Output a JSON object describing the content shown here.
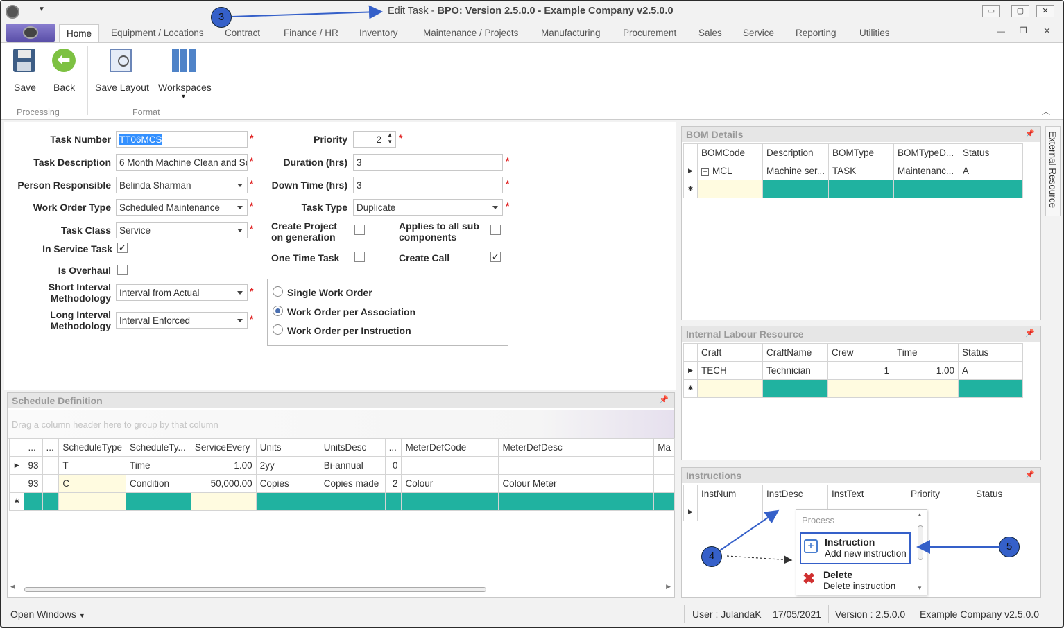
{
  "window": {
    "title": "Edit Task",
    "title_app": "BPO: Version 2.5.0.0 - Example Company v2.5.0.0",
    "minimize": "▭",
    "maximize": "▢",
    "close": "✕"
  },
  "ribbon_tabs": [
    "Home",
    "Equipment / Locations",
    "Contract",
    "Finance / HR",
    "Inventory",
    "Maintenance / Projects",
    "Manufacturing",
    "Procurement",
    "Sales",
    "Service",
    "Reporting",
    "Utilities"
  ],
  "ribbon": {
    "save": "Save",
    "back": "Back",
    "save_layout": "Save Layout",
    "workspaces": "Workspaces",
    "group_processing": "Processing",
    "group_format": "Format"
  },
  "form": {
    "task_number_label": "Task Number",
    "task_number": "TT06MCS",
    "task_description_label": "Task Description",
    "task_description": "6 Month Machine Clean and Se",
    "person_responsible_label": "Person Responsible",
    "person_responsible": "Belinda Sharman",
    "work_order_type_label": "Work Order Type",
    "work_order_type": "Scheduled Maintenance",
    "task_class_label": "Task Class",
    "task_class": "Service",
    "in_service_task_label": "In Service Task",
    "in_service_task": true,
    "is_overhaul_label": "Is Overhaul",
    "is_overhaul": false,
    "short_interval_label": "Short Interval Methodology",
    "short_interval_label_1": "Short Interval",
    "short_interval_label_2": "Methodology",
    "short_interval": "Interval from Actual",
    "long_interval_label_1": "Long Interval",
    "long_interval_label_2": "Methodology",
    "long_interval": "Interval Enforced",
    "priority_label": "Priority",
    "priority": "2",
    "duration_label": "Duration (hrs)",
    "duration": "3",
    "down_time_label": "Down Time (hrs)",
    "down_time": "3",
    "task_type_label": "Task Type",
    "task_type": "Duplicate",
    "create_project_label_1": "Create Project",
    "create_project_label_2": "on generation",
    "create_project": false,
    "applies_label_1": "Applies to all sub",
    "applies_label_2": "components",
    "applies": false,
    "one_time_label": "One Time Task",
    "one_time": false,
    "create_call_label": "Create Call",
    "create_call": true,
    "radio_single": "Single Work Order",
    "radio_association": "Work Order per Association",
    "radio_instruction": "Work Order per Instruction",
    "selected_radio": "Work Order per Association"
  },
  "schedule": {
    "title": "Schedule Definition",
    "group_hint": "Drag a column header here to group by that column",
    "columns": [
      "...",
      "...",
      "ScheduleType",
      "ScheduleTy...",
      "ServiceEvery",
      "Units",
      "UnitsDesc",
      "...",
      "MeterDefCode",
      "MeterDefDesc",
      "Ma"
    ],
    "rows": [
      [
        "93",
        "",
        "T",
        "Time",
        "1.00",
        "2yy",
        "Bi-annual",
        "0",
        "",
        "",
        ""
      ],
      [
        "93",
        "",
        "C",
        "Condition",
        "50,000.00",
        "Copies",
        "Copies made",
        "2",
        "Colour",
        "Colour Meter",
        ""
      ]
    ]
  },
  "bom": {
    "title": "BOM Details",
    "columns": [
      "BOMCode",
      "Description",
      "BOMType",
      "BOMTypeD...",
      "Status"
    ],
    "rows": [
      [
        "MCL",
        "Machine ser...",
        "TASK",
        "Maintenanc...",
        "A"
      ]
    ]
  },
  "labour": {
    "title": "Internal Labour Resource",
    "columns": [
      "Craft",
      "CraftName",
      "Crew",
      "Time",
      "Status"
    ],
    "rows": [
      [
        "TECH",
        "Technician",
        "1",
        "1.00",
        "A"
      ]
    ]
  },
  "instructions": {
    "title": "Instructions",
    "columns": [
      "InstNum",
      "InstDesc",
      "InstText",
      "Priority",
      "Status"
    ]
  },
  "context_menu": {
    "header": "Process",
    "items": [
      {
        "title": "Instruction",
        "sub": "Add new instruction"
      },
      {
        "title": "Delete",
        "sub": "Delete instruction"
      }
    ]
  },
  "side_tab": "External Resource",
  "statusbar": {
    "open_windows": "Open Windows",
    "user": "User : JulandaK",
    "date": "17/05/2021",
    "version": "Version : 2.5.0.0",
    "company": "Example Company v2.5.0.0"
  },
  "callouts": [
    "3",
    "4",
    "5"
  ],
  "colors": {
    "teal": "#20b2a0",
    "accent": "#3560c9",
    "required": "#e02020"
  }
}
